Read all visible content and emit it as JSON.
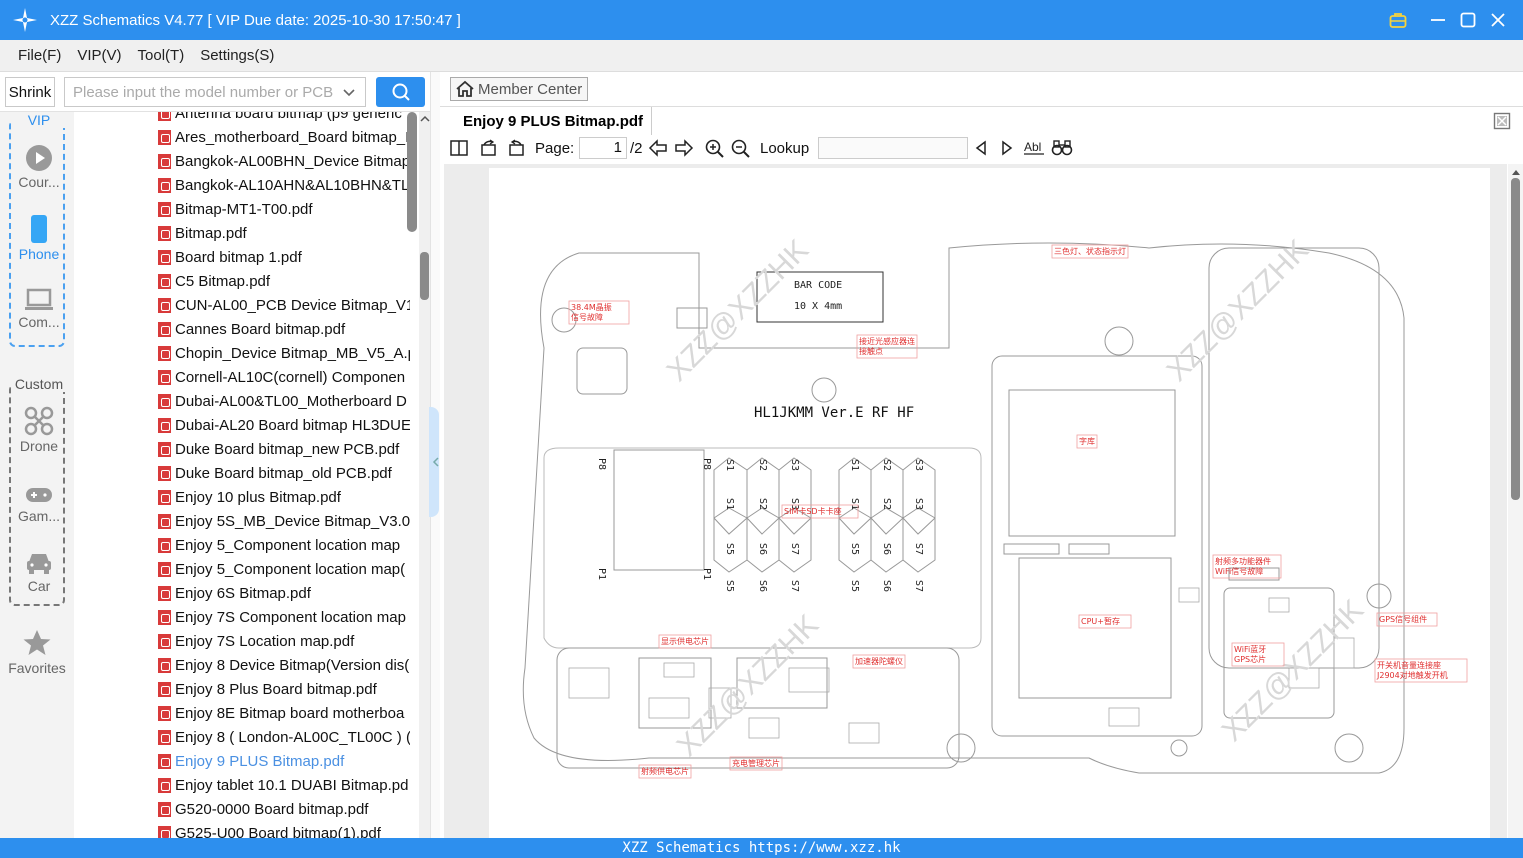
{
  "window": {
    "title": "XZZ Schematics V4.77 [ VIP Due date: 2025-10-30 17:50:47 ]"
  },
  "menu": [
    "File(F)",
    "VIP(V)",
    "Tool(T)",
    "Settings(S)"
  ],
  "left_toolbar": {
    "shrink_label": "Shrink",
    "search_placeholder": "Please input the model number or PCB"
  },
  "categories": {
    "vip_title": "VIP",
    "custom_title": "Custom",
    "items": [
      "Cour...",
      "Phone",
      "Com...",
      "Drone",
      "Gam...",
      "Car",
      "Favorites"
    ]
  },
  "files": [
    "Antenna board bitmap (p9 generic",
    "Ares_motherboard_Board bitmap_I",
    "Bangkok-AL00BHN_Device Bitmap",
    "Bangkok-AL10AHN&AL10BHN&TL",
    "Bitmap-MT1-T00.pdf",
    "Bitmap.pdf",
    "Board bitmap 1.pdf",
    "C5 Bitmap.pdf",
    "CUN-AL00_PCB Device Bitmap_V1.(",
    "Cannes Board bitmap.pdf",
    "Chopin_Device Bitmap_MB_V5_A.p",
    "Cornell-AL10C(cornell) Componen",
    "Dubai-AL00&TL00_Motherboard D",
    "Dubai-AL20 Board bitmap HL3DUE",
    "Duke Board bitmap_new PCB.pdf",
    "Duke Board bitmap_old PCB.pdf",
    "Enjoy 10 plus Bitmap.pdf",
    "Enjoy 5S_MB_Device Bitmap_V3.01",
    "Enjoy 5_Component location map",
    "Enjoy 5_Component location map(",
    "Enjoy 6S Bitmap.pdf",
    "Enjoy 7S Component location map",
    "Enjoy 7S Location map.pdf",
    "Enjoy 8 Device Bitmap(Version dis(",
    "Enjoy 8 Plus Board bitmap.pdf",
    "Enjoy 8E Bitmap board motherboa",
    "Enjoy 8 ( London-AL00C_TL00C ) (·",
    "Enjoy 9 PLUS Bitmap.pdf",
    "Enjoy tablet 10.1 DUABI Bitmap.pd",
    "G520-0000 Board bitmap.pdf",
    "G525-U00 Board bitmap(1).pdf"
  ],
  "selected_file_index": 27,
  "member_center": "Member Center",
  "doc_tab": "Enjoy 9 PLUS Bitmap.pdf",
  "pdf_toolbar": {
    "page_label": "Page:",
    "page_value": "1",
    "page_total": "/2",
    "lookup_label": "Lookup"
  },
  "schematic": {
    "barcode_title": "BAR CODE",
    "barcode_size": "10 X 4mm",
    "board_name": "HL1JKMM Ver.E RF HF",
    "watermark": "XZZ@XZZHK",
    "red_labels": [
      "三色灯、状态指示灯",
      "38.4M晶振 信号故障",
      "接近光感应器连 接触点",
      "字库",
      "SIM卡SD卡卡座",
      "射频多功能器件 WiFi信号故障",
      "CPU+暂存",
      "GPS信号组件",
      "WiFi蓝牙 GPS芯片",
      "开关机音量连接座 J2904对地触发开机",
      "显示供电芯片",
      "加速器陀螺仪",
      "射频供电芯片",
      "充电管理芯片"
    ],
    "sim_top": [
      "S1",
      "S2",
      "S3",
      "S1",
      "S2",
      "S3"
    ],
    "sim_mid_top": [
      "S1",
      "S2",
      "S3",
      "S1",
      "S2",
      "S3"
    ],
    "sim_mid_bottom": [
      "S5",
      "S6",
      "S7",
      "S5",
      "S6",
      "S7"
    ],
    "sim_bottom": [
      "S5",
      "S6",
      "S7",
      "S5",
      "S6",
      "S7"
    ],
    "pin_labels": [
      "P8",
      "P8",
      "P1",
      "P1"
    ]
  },
  "status_bar": "XZZ Schematics https://www.xzz.hk",
  "colors": {
    "accent": "#2d8fee",
    "selected_text": "#4a90e2",
    "annotation_red": "#e03030"
  }
}
